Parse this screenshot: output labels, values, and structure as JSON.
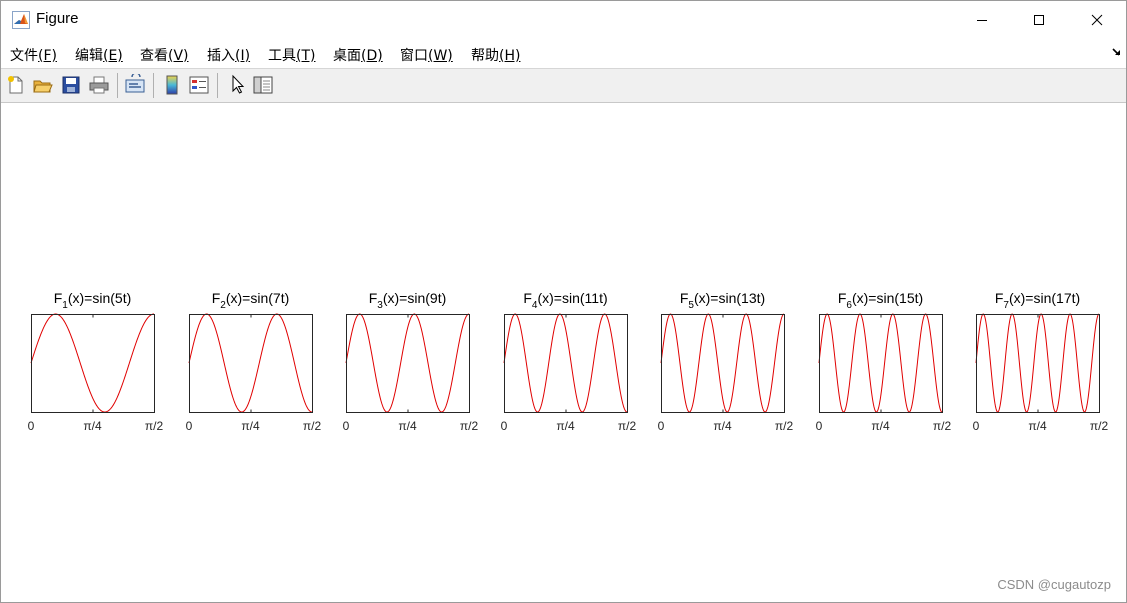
{
  "window": {
    "title": "Figure",
    "icon": "matlab-icon",
    "controls": [
      "minimize-icon",
      "maximize-icon",
      "close-icon"
    ]
  },
  "menu": {
    "items": [
      {
        "label": "文件",
        "key": "(F)"
      },
      {
        "label": "编辑",
        "key": "(E)"
      },
      {
        "label": "查看",
        "key": "(V)"
      },
      {
        "label": "插入",
        "key": "(I)"
      },
      {
        "label": "工具",
        "key": "(T)"
      },
      {
        "label": "桌面",
        "key": "(D)"
      },
      {
        "label": "窗口",
        "key": "(W)"
      },
      {
        "label": "帮助",
        "key": "(H)"
      }
    ],
    "dock_icon": "dock-arrow-icon"
  },
  "toolbar": {
    "buttons": [
      "new-figure-icon",
      "open-file-icon",
      "save-icon",
      "print-icon",
      "link-plot-icon",
      "insert-colorbar-icon",
      "insert-legend-icon",
      "edit-plot-cursor-icon",
      "property-inspector-icon"
    ]
  },
  "colors": {
    "line": "#e00000",
    "axes": "#262626",
    "background": "#ffffff"
  },
  "chart_data": [
    {
      "type": "line",
      "title": "F1(x)=sin(5t)",
      "title_base": "F",
      "title_sub": "1",
      "title_rest": "(x)=sin(5t)",
      "frequency": 5,
      "xlim": [
        0,
        1.5708
      ],
      "ylim": [
        -1,
        1
      ],
      "xticks": [
        0,
        0.7854,
        1.5708
      ],
      "xticklabels": [
        "0",
        "π/4",
        "π/2"
      ],
      "series": [
        {
          "expr": "sin(5t)",
          "color": "#e00000"
        }
      ]
    },
    {
      "type": "line",
      "title": "F2(x)=sin(7t)",
      "title_base": "F",
      "title_sub": "2",
      "title_rest": "(x)=sin(7t)",
      "frequency": 7,
      "xlim": [
        0,
        1.5708
      ],
      "ylim": [
        -1,
        1
      ],
      "xticks": [
        0,
        0.7854,
        1.5708
      ],
      "xticklabels": [
        "0",
        "π/4",
        "π/2"
      ],
      "series": [
        {
          "expr": "sin(7t)",
          "color": "#e00000"
        }
      ]
    },
    {
      "type": "line",
      "title": "F3(x)=sin(9t)",
      "title_base": "F",
      "title_sub": "3",
      "title_rest": "(x)=sin(9t)",
      "frequency": 9,
      "xlim": [
        0,
        1.5708
      ],
      "ylim": [
        -1,
        1
      ],
      "xticks": [
        0,
        0.7854,
        1.5708
      ],
      "xticklabels": [
        "0",
        "π/4",
        "π/2"
      ],
      "series": [
        {
          "expr": "sin(9t)",
          "color": "#e00000"
        }
      ]
    },
    {
      "type": "line",
      "title": "F4(x)=sin(11t)",
      "title_base": "F",
      "title_sub": "4",
      "title_rest": "(x)=sin(11t)",
      "frequency": 11,
      "xlim": [
        0,
        1.5708
      ],
      "ylim": [
        -1,
        1
      ],
      "xticks": [
        0,
        0.7854,
        1.5708
      ],
      "xticklabels": [
        "0",
        "π/4",
        "π/2"
      ],
      "series": [
        {
          "expr": "sin(11t)",
          "color": "#e00000"
        }
      ]
    },
    {
      "type": "line",
      "title": "F5(x)=sin(13t)",
      "title_base": "F",
      "title_sub": "5",
      "title_rest": "(x)=sin(13t)",
      "frequency": 13,
      "xlim": [
        0,
        1.5708
      ],
      "ylim": [
        -1,
        1
      ],
      "xticks": [
        0,
        0.7854,
        1.5708
      ],
      "xticklabels": [
        "0",
        "π/4",
        "π/2"
      ],
      "series": [
        {
          "expr": "sin(13t)",
          "color": "#e00000"
        }
      ]
    },
    {
      "type": "line",
      "title": "F6(x)=sin(15t)",
      "title_base": "F",
      "title_sub": "6",
      "title_rest": "(x)=sin(15t)",
      "frequency": 15,
      "xlim": [
        0,
        1.5708
      ],
      "ylim": [
        -1,
        1
      ],
      "xticks": [
        0,
        0.7854,
        1.5708
      ],
      "xticklabels": [
        "0",
        "π/4",
        "π/2"
      ],
      "series": [
        {
          "expr": "sin(15t)",
          "color": "#e00000"
        }
      ]
    },
    {
      "type": "line",
      "title": "F7(x)=sin(17t)",
      "title_base": "F",
      "title_sub": "7",
      "title_rest": "(x)=sin(17t)",
      "frequency": 17,
      "xlim": [
        0,
        1.5708
      ],
      "ylim": [
        -1,
        1
      ],
      "xticks": [
        0,
        0.7854,
        1.5708
      ],
      "xticklabels": [
        "0",
        "π/4",
        "π/2"
      ],
      "series": [
        {
          "expr": "sin(17t)",
          "color": "#e00000"
        }
      ]
    }
  ],
  "watermark": "CSDN @cugautozp"
}
